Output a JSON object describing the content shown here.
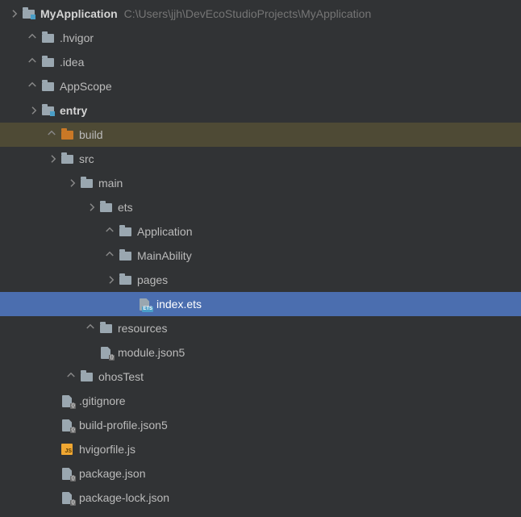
{
  "project": {
    "name": "MyApplication",
    "path": "C:\\Users\\jjh\\DevEcoStudioProjects\\MyApplication"
  },
  "tree": [
    {
      "id": "root",
      "indent": 0,
      "arrow": "down",
      "icon": "folder-module",
      "label": "MyApplication",
      "bold": true,
      "pathHint": true
    },
    {
      "id": "hvigor",
      "indent": 1,
      "arrow": "right",
      "icon": "folder",
      "label": ".hvigor"
    },
    {
      "id": "idea",
      "indent": 1,
      "arrow": "right",
      "icon": "folder",
      "label": ".idea"
    },
    {
      "id": "appscope",
      "indent": 1,
      "arrow": "right",
      "icon": "folder",
      "label": "AppScope"
    },
    {
      "id": "entry",
      "indent": 1,
      "arrow": "down",
      "icon": "folder-module",
      "label": "entry",
      "bold": true
    },
    {
      "id": "build",
      "indent": 2,
      "arrow": "right",
      "icon": "folder-orange",
      "label": "build",
      "highlight": true
    },
    {
      "id": "src",
      "indent": 2,
      "arrow": "down",
      "icon": "folder",
      "label": "src"
    },
    {
      "id": "main",
      "indent": 3,
      "arrow": "down",
      "icon": "folder",
      "label": "main"
    },
    {
      "id": "ets",
      "indent": 4,
      "arrow": "down",
      "icon": "folder",
      "label": "ets"
    },
    {
      "id": "application",
      "indent": 5,
      "arrow": "right",
      "icon": "folder",
      "label": "Application"
    },
    {
      "id": "mainability",
      "indent": 5,
      "arrow": "right",
      "icon": "folder",
      "label": "MainAbility"
    },
    {
      "id": "pages",
      "indent": 5,
      "arrow": "down",
      "icon": "folder",
      "label": "pages"
    },
    {
      "id": "indexets",
      "indent": 6,
      "arrow": "none",
      "icon": "file-ets",
      "label": "index.ets",
      "selected": true
    },
    {
      "id": "resources",
      "indent": 4,
      "arrow": "right",
      "icon": "folder",
      "label": "resources"
    },
    {
      "id": "modulejson",
      "indent": 4,
      "arrow": "none",
      "icon": "file-json",
      "label": "module.json5"
    },
    {
      "id": "ohostest",
      "indent": 3,
      "arrow": "right",
      "icon": "folder",
      "label": "ohosTest"
    },
    {
      "id": "gitignore",
      "indent": 2,
      "arrow": "none",
      "icon": "file-json",
      "label": ".gitignore"
    },
    {
      "id": "buildprofile",
      "indent": 2,
      "arrow": "none",
      "icon": "file-json",
      "label": "build-profile.json5"
    },
    {
      "id": "hvigorfile",
      "indent": 2,
      "arrow": "none",
      "icon": "file-js",
      "label": "hvigorfile.js"
    },
    {
      "id": "packagejson",
      "indent": 2,
      "arrow": "none",
      "icon": "file-json",
      "label": "package.json"
    },
    {
      "id": "packagelock",
      "indent": 2,
      "arrow": "none",
      "icon": "file-json",
      "label": "package-lock.json"
    }
  ]
}
